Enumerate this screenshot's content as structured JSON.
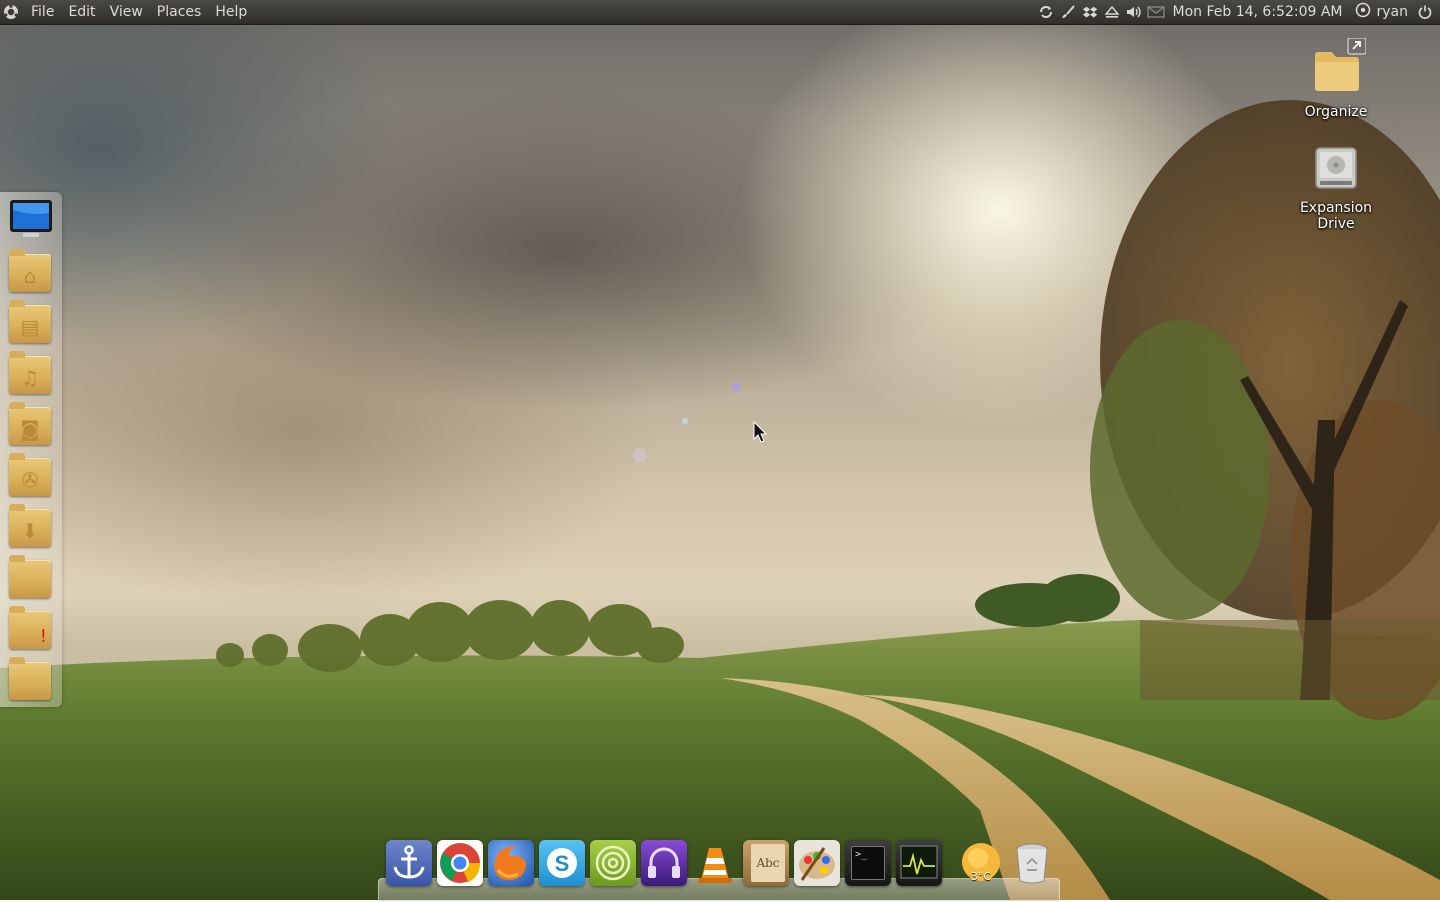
{
  "panel": {
    "menu": {
      "file": "File",
      "edit": "Edit",
      "view": "View",
      "places": "Places",
      "help": "Help"
    },
    "tray_icons": [
      "sync-icon",
      "brush-icon",
      "dropbox-icon",
      "eject-icon",
      "volume-icon",
      "mail-icon"
    ],
    "clock": "Mon Feb 14, 6:52:09 AM",
    "username": "ryan"
  },
  "desktop_icons": {
    "organize": "Organize",
    "expansion_drive": "Expansion Drive"
  },
  "sidebar": {
    "items": [
      {
        "icon": "computer-icon"
      },
      {
        "icon": "home-folder-icon"
      },
      {
        "icon": "documents-folder-icon"
      },
      {
        "icon": "music-folder-icon"
      },
      {
        "icon": "pictures-folder-icon"
      },
      {
        "icon": "videos-folder-icon"
      },
      {
        "icon": "downloads-folder-icon"
      },
      {
        "icon": "folder-icon"
      },
      {
        "icon": "folder-warning-icon"
      },
      {
        "icon": "folder-icon"
      }
    ]
  },
  "dock": {
    "items": [
      {
        "icon": "anchor-icon"
      },
      {
        "icon": "chrome-icon"
      },
      {
        "icon": "firefox-icon"
      },
      {
        "icon": "skype-icon"
      },
      {
        "icon": "spiral-icon"
      },
      {
        "icon": "headphones-icon"
      },
      {
        "icon": "vlc-icon"
      },
      {
        "icon": "dictionary-icon"
      },
      {
        "icon": "paint-icon"
      },
      {
        "icon": "terminal-icon"
      },
      {
        "icon": "system-monitor-icon"
      },
      {
        "icon": "weather-icon"
      },
      {
        "icon": "trash-icon"
      }
    ],
    "dictionary_text": "Abc",
    "weather_temp": "3°C",
    "terminal_prompt": ">_"
  },
  "colors": {
    "panel_bg": "#3b3a36",
    "folder": "#d9ae57",
    "accent_sun": "#f5b83a"
  }
}
